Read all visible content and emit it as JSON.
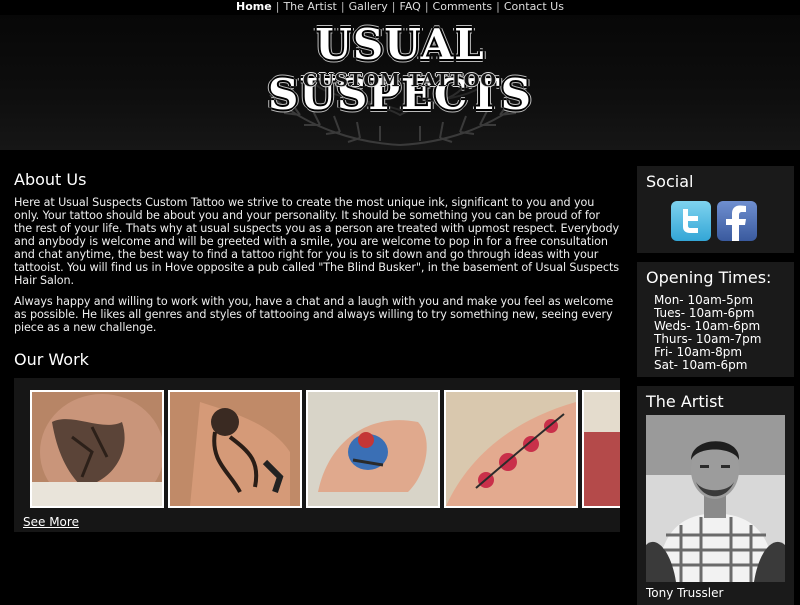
{
  "nav": {
    "items": [
      {
        "label": "Home",
        "active": true
      },
      {
        "label": "The Artist",
        "active": false
      },
      {
        "label": "Gallery",
        "active": false
      },
      {
        "label": "FAQ",
        "active": false
      },
      {
        "label": "Comments",
        "active": false
      },
      {
        "label": "Contact Us",
        "active": false
      }
    ],
    "separator": "|"
  },
  "header": {
    "logo_title": "USUAL SUSPECTS",
    "logo_subtitle": "CUSTOM TATTOO"
  },
  "about": {
    "title": "About Us",
    "paragraphs": [
      "Here at Usual Suspects Custom Tattoo we strive to create the most unique ink, significant to you and you only. Your tattoo should be about you and your personality. It should be something you can be proud of for the rest of your life. Thats why at usual suspects you as a person are treated with upmost respect. Everybody and anybody is welcome and will be greeted with a smile, you are welcome to pop in for a free consultation and chat anytime, the best way to find a tattoo right for you is to sit down and go through ideas with your tattooist. You will find us in Hove opposite a pub called \"The Blind Busker\", in the basement of Usual Suspects Hair Salon.",
      "Always happy and willing to work with you, have a chat and a laugh with you and make you feel as welcome as possible. He likes all genres and styles of tattooing and always willing to try something new, seeing every piece as a new challenge."
    ]
  },
  "work": {
    "title": "Our Work",
    "see_more": "See More"
  },
  "social": {
    "title": "Social",
    "icons": [
      "twitter-icon",
      "facebook-icon"
    ]
  },
  "hours": {
    "title": "Opening Times:",
    "days": [
      "Mon- 10am-5pm",
      "Tues- 10am-6pm",
      "Weds- 10am-6pm",
      "Thurs- 10am-7pm",
      "Fri- 10am-8pm",
      "Sat- 10am-6pm"
    ]
  },
  "artist": {
    "title": "The Artist",
    "name": "Tony Trussler"
  },
  "colors": {
    "background": "#000000",
    "panel": "#1a1a1a",
    "text": "#ffffff",
    "twitter": "#33a6d6",
    "facebook": "#3a5a9e"
  }
}
